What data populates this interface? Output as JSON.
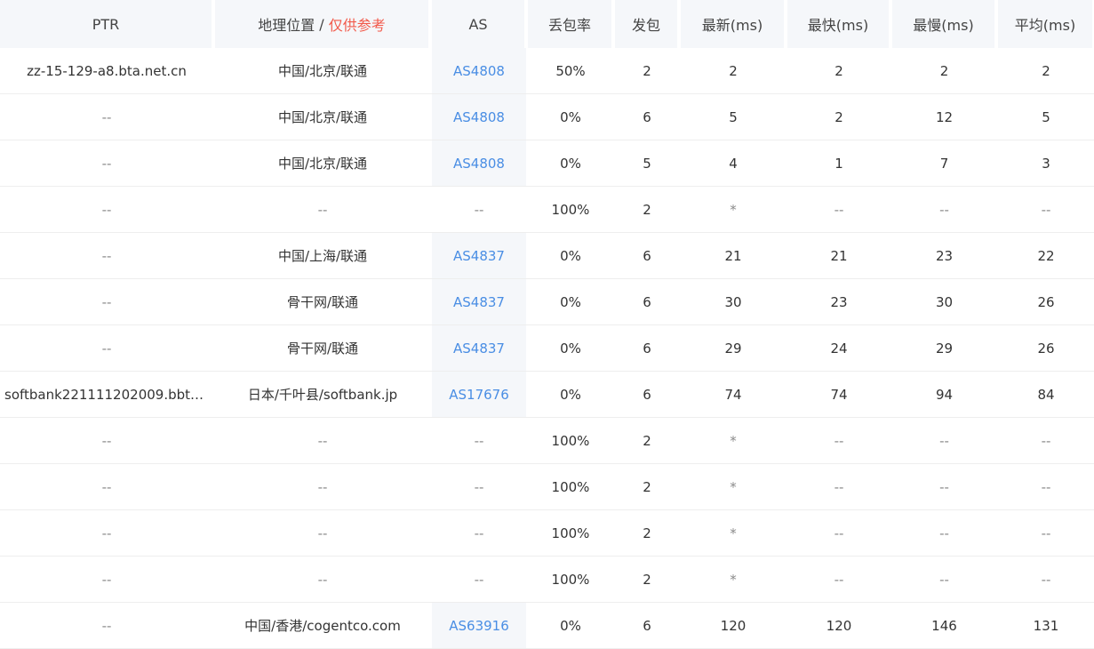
{
  "headers": {
    "ptr": "PTR",
    "geo": "地理位置",
    "geo_sep": "/",
    "geo_note": "仅供参考",
    "as": "AS",
    "loss": "丢包率",
    "sent": "发包",
    "last": "最新(ms)",
    "best": "最快(ms)",
    "worst": "最慢(ms)",
    "avg": "平均(ms)"
  },
  "rows": [
    {
      "ptr": "zz-15-129-a8.bta.net.cn",
      "geo": "中国/北京/联通",
      "as": "AS4808",
      "loss": "50%",
      "sent": "2",
      "last": "2",
      "best": "2",
      "worst": "2",
      "avg": "2"
    },
    {
      "ptr": "--",
      "geo": "中国/北京/联通",
      "as": "AS4808",
      "loss": "0%",
      "sent": "6",
      "last": "5",
      "best": "2",
      "worst": "12",
      "avg": "5"
    },
    {
      "ptr": "--",
      "geo": "中国/北京/联通",
      "as": "AS4808",
      "loss": "0%",
      "sent": "5",
      "last": "4",
      "best": "1",
      "worst": "7",
      "avg": "3"
    },
    {
      "ptr": "--",
      "geo": "--",
      "as": "--",
      "loss": "100%",
      "sent": "2",
      "last": "*",
      "best": "--",
      "worst": "--",
      "avg": "--"
    },
    {
      "ptr": "--",
      "geo": "中国/上海/联通",
      "as": "AS4837",
      "loss": "0%",
      "sent": "6",
      "last": "21",
      "best": "21",
      "worst": "23",
      "avg": "22"
    },
    {
      "ptr": "--",
      "geo": "骨干网/联通",
      "as": "AS4837",
      "loss": "0%",
      "sent": "6",
      "last": "30",
      "best": "23",
      "worst": "30",
      "avg": "26"
    },
    {
      "ptr": "--",
      "geo": "骨干网/联通",
      "as": "AS4837",
      "loss": "0%",
      "sent": "6",
      "last": "29",
      "best": "24",
      "worst": "29",
      "avg": "26"
    },
    {
      "ptr": "softbank221111202009.bbte...",
      "geo": "日本/千叶县/softbank.jp",
      "as": "AS17676",
      "loss": "0%",
      "sent": "6",
      "last": "74",
      "best": "74",
      "worst": "94",
      "avg": "84"
    },
    {
      "ptr": "--",
      "geo": "--",
      "as": "--",
      "loss": "100%",
      "sent": "2",
      "last": "*",
      "best": "--",
      "worst": "--",
      "avg": "--"
    },
    {
      "ptr": "--",
      "geo": "--",
      "as": "--",
      "loss": "100%",
      "sent": "2",
      "last": "*",
      "best": "--",
      "worst": "--",
      "avg": "--"
    },
    {
      "ptr": "--",
      "geo": "--",
      "as": "--",
      "loss": "100%",
      "sent": "2",
      "last": "*",
      "best": "--",
      "worst": "--",
      "avg": "--"
    },
    {
      "ptr": "--",
      "geo": "--",
      "as": "--",
      "loss": "100%",
      "sent": "2",
      "last": "*",
      "best": "--",
      "worst": "--",
      "avg": "--"
    },
    {
      "ptr": "--",
      "geo": "中国/香港/cogentco.com",
      "as": "AS63916",
      "loss": "0%",
      "sent": "6",
      "last": "120",
      "best": "120",
      "worst": "146",
      "avg": "131"
    }
  ],
  "colors": {
    "header_bg": "#f5f7fa",
    "as_link": "#4a8ee4",
    "note_red": "#f25a4b",
    "row_divider": "#eeeeee"
  }
}
